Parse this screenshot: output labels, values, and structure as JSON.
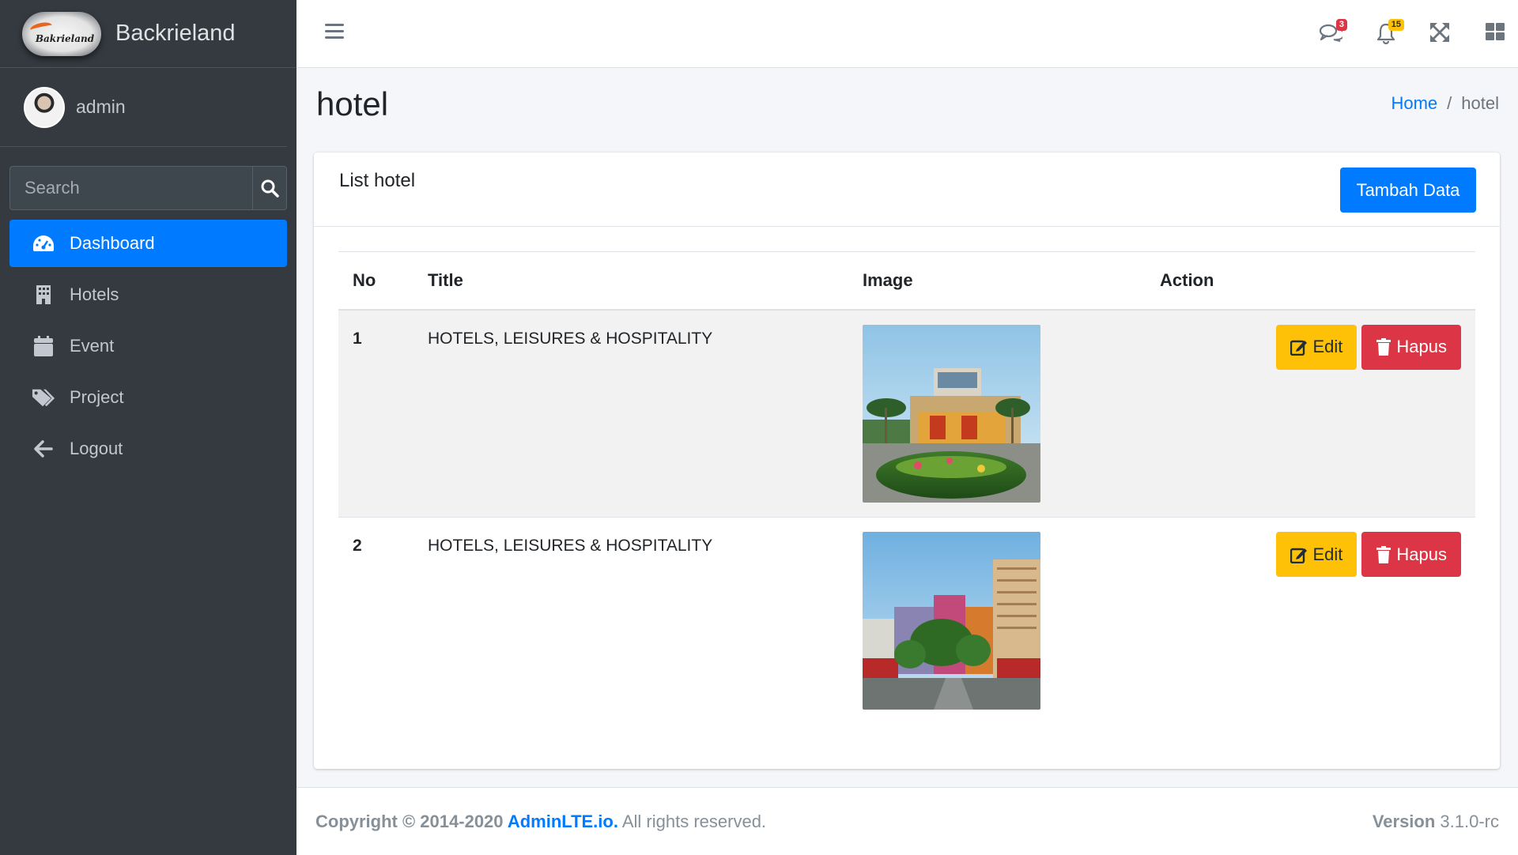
{
  "brand": {
    "name": "Backrieland",
    "logo_text": "Bakrieland"
  },
  "user": {
    "name": "admin"
  },
  "search": {
    "placeholder": "Search"
  },
  "nav": [
    {
      "label": "Dashboard",
      "icon": "tachometer-icon",
      "active": true
    },
    {
      "label": "Hotels",
      "icon": "building-icon"
    },
    {
      "label": "Event",
      "icon": "calendar-icon"
    },
    {
      "label": "Project",
      "icon": "tags-icon"
    },
    {
      "label": "Logout",
      "icon": "arrow-left-icon"
    }
  ],
  "topbar": {
    "messages_badge": "3",
    "notifications_badge": "15"
  },
  "page": {
    "title": "hotel"
  },
  "breadcrumb": {
    "home": "Home",
    "separator": "/",
    "current": "hotel"
  },
  "card": {
    "title": "List hotel",
    "add_button": "Tambah Data"
  },
  "table": {
    "headers": [
      "No",
      "Title",
      "Image",
      "Action"
    ],
    "rows": [
      {
        "no": "1",
        "title": "HOTELS, LEISURES & HOSPITALITY",
        "edit": "Edit",
        "delete": "Hapus"
      },
      {
        "no": "2",
        "title": "HOTELS, LEISURES & HOSPITALITY",
        "edit": "Edit",
        "delete": "Hapus"
      }
    ]
  },
  "footer": {
    "copyright": "Copyright © 2014-2020 ",
    "brand_link": "AdminLTE.io.",
    "rights": " All rights reserved.",
    "version_label": "Version",
    "version": " 3.1.0-rc"
  },
  "colors": {
    "sidebar_bg": "#343a40",
    "primary": "#007bff",
    "warning": "#ffc107",
    "danger": "#dc3545"
  }
}
